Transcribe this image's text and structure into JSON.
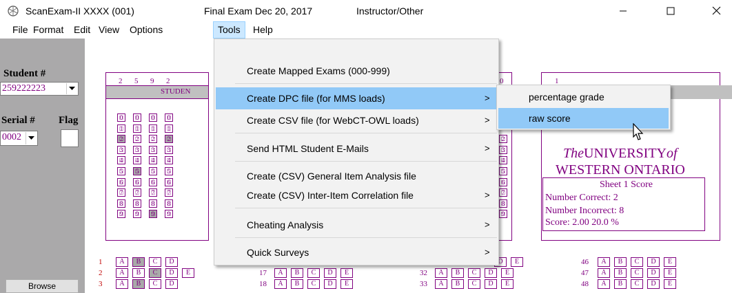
{
  "window": {
    "app_title": "ScanExam-II  XXXX (001)",
    "exam_title": "Final Exam Dec 20, 2017",
    "role": "Instructor/Other"
  },
  "menubar": {
    "items": [
      "File",
      "Format",
      "Edit",
      "View",
      "Options",
      "Tools",
      "Help"
    ],
    "active": "Tools"
  },
  "left_panel": {
    "student_label": "Student #",
    "student_value": "259222223",
    "serial_label": "Serial #",
    "flag_label": "Flag",
    "serial_value": "0002",
    "browse_label": "Browse"
  },
  "sheet": {
    "student_digits_top": [
      "2",
      "5",
      "9",
      "2"
    ],
    "student_header": "STUDEN",
    "right_top_zero": "0",
    "right_top_one": "1",
    "digit_rows": [
      "0",
      "1",
      "2",
      "3",
      "4",
      "5",
      "6",
      "7",
      "8",
      "9"
    ],
    "right_row_labels": [
      "4",
      "5"
    ],
    "university_line1_a": "The",
    "university_line1_b": "UNIVERSITY",
    "university_line1_c": "of",
    "university_line2": "WESTERN ONTARIO",
    "score_title": "Sheet 1 Score",
    "number_correct": "Number Correct:  2",
    "number_incorrect": "Number Incorrect:  8",
    "score_line": "Score:  2.00   20.0 %",
    "answer_letters": [
      "A",
      "B",
      "C",
      "D",
      "E"
    ],
    "question_numbers_left": [
      "1",
      "2",
      "3"
    ],
    "question_numbers_mid": [
      "17",
      "18"
    ],
    "question_numbers_mid2": [
      "32",
      "33"
    ],
    "question_numbers_right": [
      "46",
      "47",
      "48"
    ]
  },
  "tools_menu": {
    "items": [
      {
        "label": "Create Mapped Exams (000-999)",
        "submenu": false
      },
      {
        "label": "Create DPC file (for  MMS loads)",
        "submenu": true
      },
      {
        "label": "Create CSV file (for WebCT-OWL loads)",
        "submenu": true
      },
      {
        "label": "Send HTML Student E-Mails",
        "submenu": true
      },
      {
        "label": "Create (CSV) General Item Analysis file",
        "submenu": false
      },
      {
        "label": "Create (CSV) Inter-Item Correlation file",
        "submenu": true
      },
      {
        "label": "Cheating Analysis",
        "submenu": true
      },
      {
        "label": "Quick Surveys",
        "submenu": true
      }
    ],
    "highlighted": "Create DPC file (for  MMS loads)",
    "chevron": ">"
  },
  "dpc_submenu": {
    "items": [
      "percentage grade",
      "raw score"
    ],
    "highlighted": "raw score"
  },
  "colors": {
    "sheet_ink": "#800080",
    "panel_gray": "#aaa9aa",
    "menu_bg": "#f2f2f2",
    "highlight": "#91c9f7",
    "menubar_active": "#cce8ff"
  }
}
